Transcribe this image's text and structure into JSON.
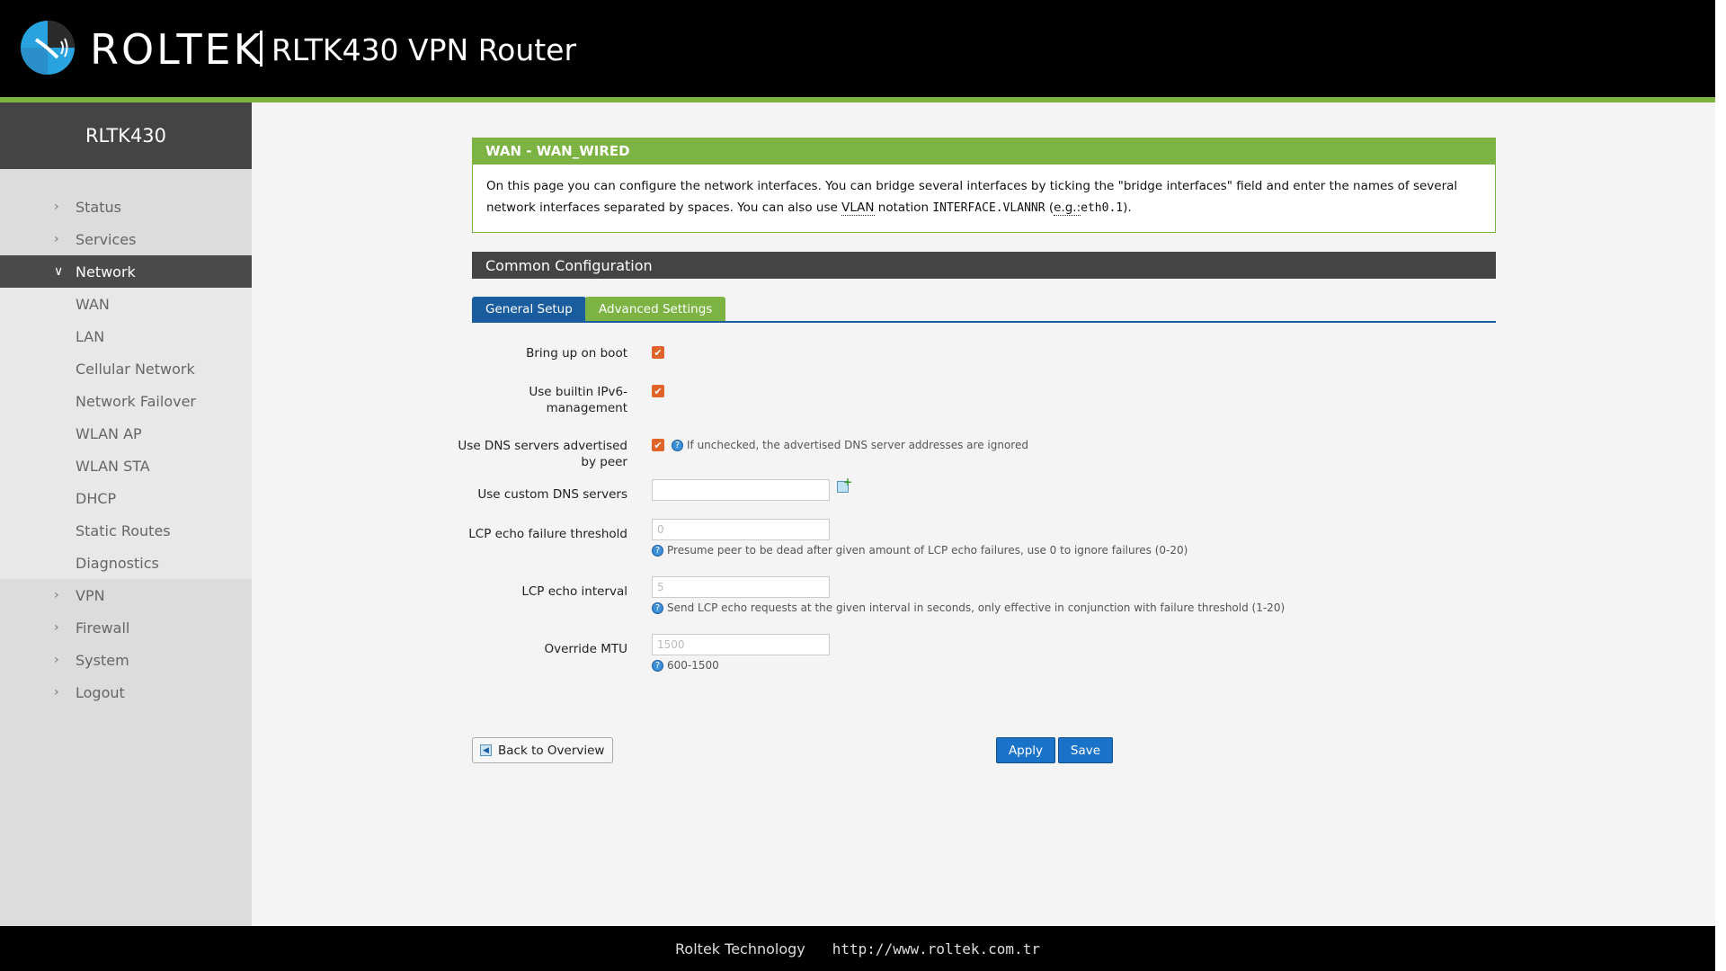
{
  "header": {
    "brand": "ROLTEK",
    "title": "RLTK430 VPN Router",
    "logo_icon": "roltek-logo-icon"
  },
  "sidebar": {
    "device_name": "RLTK430",
    "items": [
      {
        "label": "Status",
        "icon": "chevron-right-icon"
      },
      {
        "label": "Services",
        "icon": "chevron-right-icon"
      },
      {
        "label": "Network",
        "icon": "chevron-down-icon",
        "active": true
      },
      {
        "label": "VPN",
        "icon": "chevron-right-icon"
      },
      {
        "label": "Firewall",
        "icon": "chevron-right-icon"
      },
      {
        "label": "System",
        "icon": "chevron-right-icon"
      },
      {
        "label": "Logout",
        "icon": "chevron-right-icon"
      }
    ],
    "network_sub": [
      "WAN",
      "LAN",
      "Cellular Network",
      "Network Failover",
      "WLAN AP",
      "WLAN STA",
      "DHCP",
      "Static Routes",
      "Diagnostics"
    ]
  },
  "panel": {
    "title": "WAN - WAN_WIRED",
    "desc_part1": "On this page you can configure the network interfaces. You can bridge several interfaces by ticking the \"bridge interfaces\" field and enter the names of several network interfaces separated by spaces. You can also use ",
    "desc_vlan": "VLAN",
    "desc_part2": " notation ",
    "desc_code1": "INTERFACE.VLANNR",
    "desc_part3": " (",
    "desc_eg": "e.g.:",
    "desc_code2": "eth0.1",
    "desc_part4": ")."
  },
  "section": {
    "title": "Common Configuration"
  },
  "tabs": {
    "general": "General Setup",
    "advanced": "Advanced Settings"
  },
  "form": {
    "bring_up_on_boot": {
      "label": "Bring up on boot",
      "checked": true
    },
    "builtin_ipv6": {
      "label": "Use builtin IPv6-management",
      "checked": true
    },
    "peer_dns": {
      "label": "Use DNS servers advertised by peer",
      "checked": true,
      "hint": "If unchecked, the advertised DNS server addresses are ignored"
    },
    "custom_dns": {
      "label": "Use custom DNS servers",
      "value": ""
    },
    "lcp_fail": {
      "label": "LCP echo failure threshold",
      "placeholder": "0",
      "hint": "Presume peer to be dead after given amount of LCP echo failures, use 0 to ignore failures (0-20)"
    },
    "lcp_interval": {
      "label": "LCP echo interval",
      "placeholder": "5",
      "hint": "Send LCP echo requests at the given interval in seconds, only effective in conjunction with failure threshold (1-20)"
    },
    "mtu": {
      "label": "Override MTU",
      "placeholder": "1500",
      "hint": "600-1500"
    }
  },
  "buttons": {
    "back": "Back to Overview",
    "apply": "Apply",
    "save": "Save"
  },
  "footer": {
    "company": "Roltek Technology",
    "url": "http://www.roltek.com.tr"
  },
  "colors": {
    "accent_green": "#7cb342",
    "primary_blue": "#1a5d9e",
    "checkbox_orange": "#e0642a",
    "header_black": "#000000"
  }
}
